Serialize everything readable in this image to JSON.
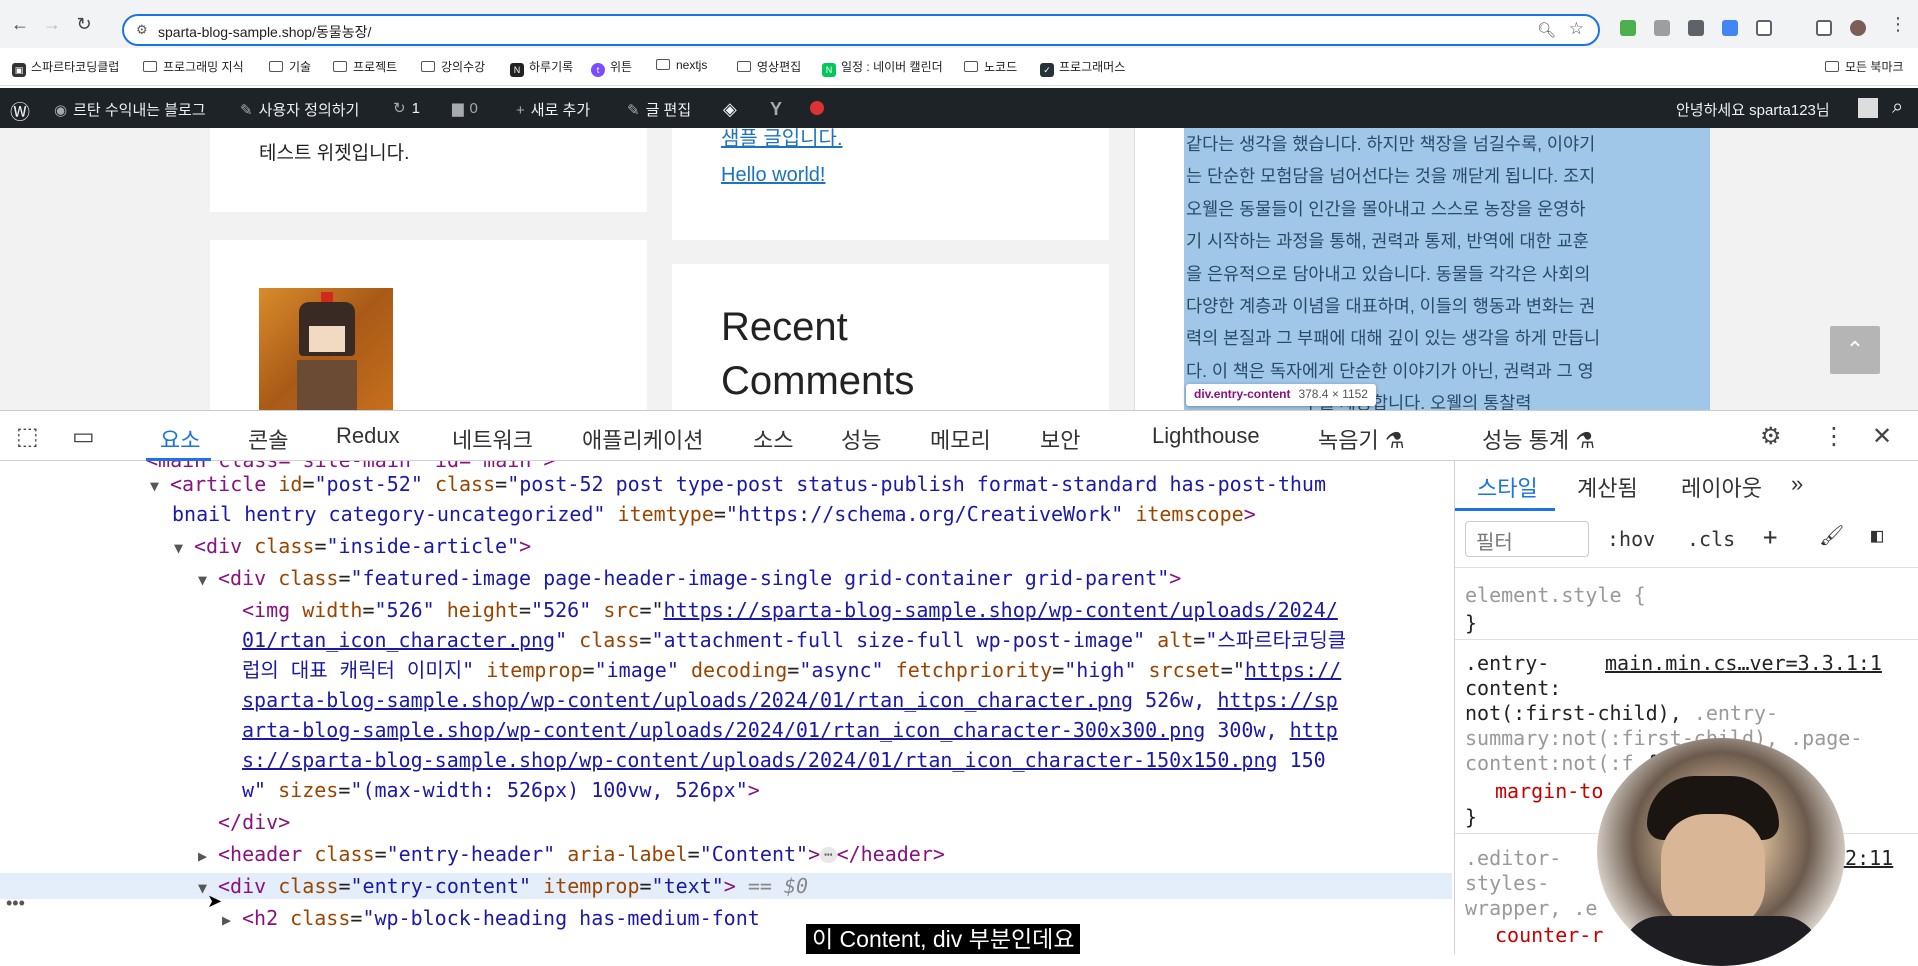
{
  "browser": {
    "url": "sparta-blog-sample.shop/동물농장/",
    "bookmarks": [
      "스파르타코딩클럽",
      "프로그래밍 지식",
      "기술",
      "프로젝트",
      "강의수강",
      "하루기록",
      "위튼",
      "nextjs",
      "영상편집",
      "일정 : 네이버 캘린더",
      "노코드",
      "프로그래머스"
    ],
    "all_bookmarks": "모든 북마크"
  },
  "wpbar": {
    "site_name": "르탄 수익내는 블로그",
    "customize": "사용자 정의하기",
    "updates_count": "1",
    "comments_count": "0",
    "new_content": "새로 추가",
    "edit_post": "글 편집",
    "greeting": "안녕하세요 sparta123님"
  },
  "page": {
    "widget_text": "테스트 위젯입니다.",
    "link_partial": "샘플 글입니다.",
    "link_hello": "Hello world!",
    "recent_comments_line1": "Recent",
    "recent_comments_line2": "Comments",
    "article_lines": [
      "같다는 생각을 했습니다. 하지만 책장을 넘길수록, 이야기",
      "는 단순한 모험담을 넘어선다는 것을 깨닫게 됩니다. 조지",
      "오웰은 동물들이 인간을 몰아내고 스스로 농장을 운영하",
      "기 시작하는 과정을 통해, 권력과 통제, 반역에 대한 교훈",
      "을 은유적으로 담아내고 있습니다. 동물들 각각은 사회의",
      "다양한 계층과 이념을 대표하며, 이들의 행동과 변화는 권",
      "력의 본질과 그 부패에 대해 깊이 있는 생각을 하게 만듭니",
      "다. 이 책은 독자에게 단순한 이야기가 아닌, 권력과 그 영",
      "                        구를 제공합니다. 오웰의 통찰력"
    ],
    "tooltip_selector": "div.entry-content",
    "tooltip_dims": "378.4 × 1152"
  },
  "devtools": {
    "tabs": [
      "요소",
      "콘솔",
      "Redux",
      "네트워크",
      "애플리케이션",
      "소스",
      "성능",
      "메모리",
      "보안",
      "Lighthouse",
      "녹음기",
      "성능 통계"
    ],
    "side_tabs": [
      "스타일",
      "계산됨",
      "레이아웃"
    ],
    "filter_placeholder": "필터",
    "hov": ":hov",
    "cls": ".cls",
    "dom": {
      "l0": "<main class=\"site-main\" id=\"main\">",
      "article_open": "<article",
      "article_id_attr": "id",
      "article_id": "\"post-52\"",
      "article_class_attr": "class",
      "article_class_1": "\"post-52 post type-post status-publish format-standard has-post-thum",
      "article_class_2": "bnail hentry category-uncategorized\"",
      "article_itemtype_attr": "itemtype",
      "article_itemtype": "\"https://schema.org/CreativeWork\"",
      "article_itemscope": "itemscope",
      "inside_article_open": "<div",
      "inside_article_class": "\"inside-article\"",
      "featured_class": "\"featured-image page-header-image-single grid-container grid-parent\"",
      "img_width": "\"526\"",
      "img_height": "\"526\"",
      "img_src_1": "https://sparta-blog-sample.shop/wp-content/uploads/2024/",
      "img_src_2": "01/rtan_icon_character.png",
      "img_class": "\"attachment-full size-full wp-post-image\"",
      "img_alt_1": "\"스파르타코딩클",
      "img_alt_2": "럽의 대표 캐릭터 이미지\"",
      "img_itemprop": "\"image\"",
      "img_decoding": "\"async\"",
      "img_fetchpriority": "\"high\"",
      "srcset_1": "https://",
      "srcset_2": "sparta-blog-sample.shop/wp-content/uploads/2024/01/rtan_icon_character.png",
      "srcset_2w": " 526w, ",
      "srcset_3a": "https://sp",
      "srcset_3b": "arta-blog-sample.shop/wp-content/uploads/2024/01/rtan_icon_character-300x300.png",
      "srcset_3w": " 300w, ",
      "srcset_4a": "http",
      "srcset_4b": "s://sparta-blog-sample.shop/wp-content/uploads/2024/01/rtan_icon_character-150x150.png",
      "srcset_4w": " 150",
      "srcset_5": "w\"",
      "sizes": "\"(max-width: 526px) 100vw, 526px\"",
      "div_close": "</div>",
      "header_class": "\"entry-header\"",
      "header_aria": "\"Content\"",
      "entry_content_class": "\"entry-content\"",
      "entry_itemprop": "\"text\"",
      "eq_dollar": "== $0",
      "h2_class": "\"wp-block-heading has-medium-font"
    },
    "styles": {
      "element_style": "element.style {",
      "close_brace": "}",
      "rule_selector_1": ".entry-",
      "rule_selector_2": "content:",
      "rule_selector_3": "not(:first-child),",
      "rule_selector_dim_1": " .entry-",
      "rule_selector_dim_2": "summary:not(:first-child), .page-",
      "rule_selector_dim_3": "content:not(:f",
      "rule_source": "main.min.cs…ver=3.3.1:1",
      "rule_prop": "margin-to",
      "editor_1": ".editor-",
      "editor_2": "styles-",
      "editor_3": "wrapper, .e",
      "editor_src": ".2:11",
      "editor_prop": "counter-r"
    }
  },
  "subtitle": "이 Content, div 부분인데요",
  "colors": {
    "accent": "#1a73e8",
    "wp_bar": "#1d2327",
    "selection_highlight": "#6fa8dc",
    "tag": "#881280",
    "attr_name": "#994500",
    "attr_value": "#1a1aa6"
  }
}
